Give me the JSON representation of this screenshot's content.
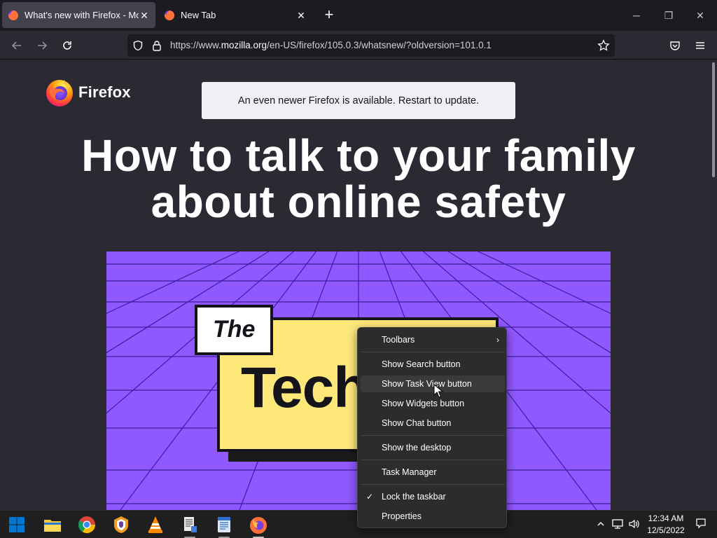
{
  "tabs": [
    {
      "title": "What's new with Firefox - More",
      "active": true
    },
    {
      "title": "New Tab",
      "active": false
    }
  ],
  "nav": {
    "url_prefix": "https://www.",
    "url_domain": "mozilla.org",
    "url_rest": "/en-US/firefox/105.0.3/whatsnew/?oldversion=101.0.1"
  },
  "page": {
    "logo_text": "Firefox",
    "update_banner": "An even newer Firefox is available. Restart to update.",
    "headline_line1": "How to talk to your family",
    "headline_line2": "about online safety",
    "hero_the": "The",
    "hero_tech": "Tech"
  },
  "context_menu": {
    "items": [
      {
        "label": "Toolbars",
        "submenu": true
      },
      {
        "label": "Show Search button"
      },
      {
        "label": "Show Task View button",
        "hovered": true
      },
      {
        "label": "Show Widgets button"
      },
      {
        "label": "Show Chat button"
      },
      {
        "label": "Show the desktop"
      },
      {
        "label": "Task Manager"
      },
      {
        "label": "Lock the taskbar",
        "checked": true
      },
      {
        "label": "Properties"
      }
    ]
  },
  "taskbar": {
    "apps": [
      "start-icon",
      "file-explorer-icon",
      "chrome-icon",
      "brave-icon",
      "vlc-icon",
      "notepad-icon",
      "reader-icon",
      "firefox-icon"
    ],
    "time": "12:34 AM",
    "date": "12/5/2022"
  },
  "colors": {
    "accent_purple": "#9059ff",
    "hero_yellow": "#ffe87a",
    "browser_bg": "#2b2a33",
    "tabstrip_bg": "#1c1b22"
  }
}
